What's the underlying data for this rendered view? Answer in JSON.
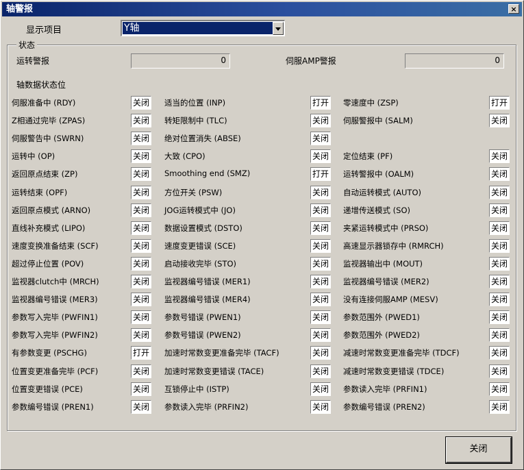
{
  "window": {
    "title": "轴警报",
    "close_glyph": "×"
  },
  "display": {
    "label": "显示项目",
    "selected": "Y轴"
  },
  "status": {
    "group_title": "状态",
    "op_alarm_label": "运转警报",
    "op_alarm_value": "0",
    "servo_alarm_label": "伺服AMP警报",
    "servo_alarm_value": "0",
    "bits_title": "轴数据状态位"
  },
  "rows": [
    [
      {
        "label": "伺服准备中 (RDY)",
        "value": "关闭"
      },
      {
        "label": "适当的位置 (INP)",
        "value": "打开"
      },
      {
        "label": "零速度中 (ZSP)",
        "value": "打开"
      }
    ],
    [
      {
        "label": "Z相通过完毕 (ZPAS)",
        "value": "关闭"
      },
      {
        "label": "转矩限制中 (TLC)",
        "value": "关闭"
      },
      {
        "label": "伺服警报中 (SALM)",
        "value": "关闭"
      }
    ],
    [
      {
        "label": "伺服警告中 (SWRN)",
        "value": "关闭"
      },
      {
        "label": "绝对位置消失 (ABSE)",
        "value": "关闭"
      },
      null
    ],
    [
      {
        "label": "运转中 (OP)",
        "value": "关闭"
      },
      {
        "label": "大致 (CPO)",
        "value": "关闭"
      },
      {
        "label": "定位结束 (PF)",
        "value": "关闭"
      }
    ],
    [
      {
        "label": "返回原点结束 (ZP)",
        "value": "关闭"
      },
      {
        "label": "Smoothing end (SMZ)",
        "value": "打开"
      },
      {
        "label": "运转警报中 (OALM)",
        "value": "关闭"
      }
    ],
    [
      {
        "label": "运转结束 (OPF)",
        "value": "关闭"
      },
      {
        "label": "方位开关 (PSW)",
        "value": "关闭"
      },
      {
        "label": "自动运转模式 (AUTO)",
        "value": "关闭"
      }
    ],
    [
      {
        "label": "返回原点模式 (ARNO)",
        "value": "关闭"
      },
      {
        "label": "JOG运转模式中 (JO)",
        "value": "关闭"
      },
      {
        "label": "递增传送模式 (SO)",
        "value": "关闭"
      }
    ],
    [
      {
        "label": "直线补充模式 (LIPO)",
        "value": "关闭"
      },
      {
        "label": "数据设置模式 (DSTO)",
        "value": "关闭"
      },
      {
        "label": "夹紧运转模式中 (PRSO)",
        "value": "关闭"
      }
    ],
    [
      {
        "label": "速度变换准备结束 (SCF)",
        "value": "关闭"
      },
      {
        "label": "速度变更错误 (SCE)",
        "value": "关闭"
      },
      {
        "label": "高速显示器锁存中 (RMRCH)",
        "value": "关闭"
      }
    ],
    [
      {
        "label": "超过停止位置 (POV)",
        "value": "关闭"
      },
      {
        "label": "启动接收完毕 (STO)",
        "value": "关闭"
      },
      {
        "label": "监视器输出中 (MOUT)",
        "value": "关闭"
      }
    ],
    [
      {
        "label": "监视器clutch中 (MRCH)",
        "value": "关闭"
      },
      {
        "label": "监视器编号错误 (MER1)",
        "value": "关闭"
      },
      {
        "label": "监视器编号错误 (MER2)",
        "value": "关闭"
      }
    ],
    [
      {
        "label": "监视器编号错误 (MER3)",
        "value": "关闭"
      },
      {
        "label": "监视器编号错误 (MER4)",
        "value": "关闭"
      },
      {
        "label": "没有连接伺服AMP (MESV)",
        "value": "关闭"
      }
    ],
    [
      {
        "label": "参数写入完毕 (PWFIN1)",
        "value": "关闭"
      },
      {
        "label": "参数号错误 (PWEN1)",
        "value": "关闭"
      },
      {
        "label": "参数范围外 (PWED1)",
        "value": "关闭"
      }
    ],
    [
      {
        "label": "参数写入完毕 (PWFIN2)",
        "value": "关闭"
      },
      {
        "label": "参数号错误 (PWEN2)",
        "value": "关闭"
      },
      {
        "label": "参数范围外 (PWED2)",
        "value": "关闭"
      }
    ],
    [
      {
        "label": "有参数变更 (PSCHG)",
        "value": "打开"
      },
      {
        "label": "加速时常数变更准备完毕 (TACF)",
        "value": "关闭"
      },
      {
        "label": "减速时常数变更准备完毕 (TDCF)",
        "value": "关闭"
      }
    ],
    [
      {
        "label": "位置变更准备完毕 (PCF)",
        "value": "关闭"
      },
      {
        "label": "加速时常数变更错误 (TACE)",
        "value": "关闭"
      },
      {
        "label": "减速时常数变更错误 (TDCE)",
        "value": "关闭"
      }
    ],
    [
      {
        "label": "位置变更错误 (PCE)",
        "value": "关闭"
      },
      {
        "label": "互锁停止中 (ISTP)",
        "value": "关闭"
      },
      {
        "label": "参数读入完毕 (PRFIN1)",
        "value": "关闭"
      }
    ],
    [
      {
        "label": "参数编号错误 (PREN1)",
        "value": "关闭"
      },
      {
        "label": "参数读入完毕 (PRFIN2)",
        "value": "关闭"
      },
      {
        "label": "参数编号错误 (PREN2)",
        "value": "关闭"
      }
    ]
  ],
  "footer": {
    "close_label": "关闭"
  }
}
